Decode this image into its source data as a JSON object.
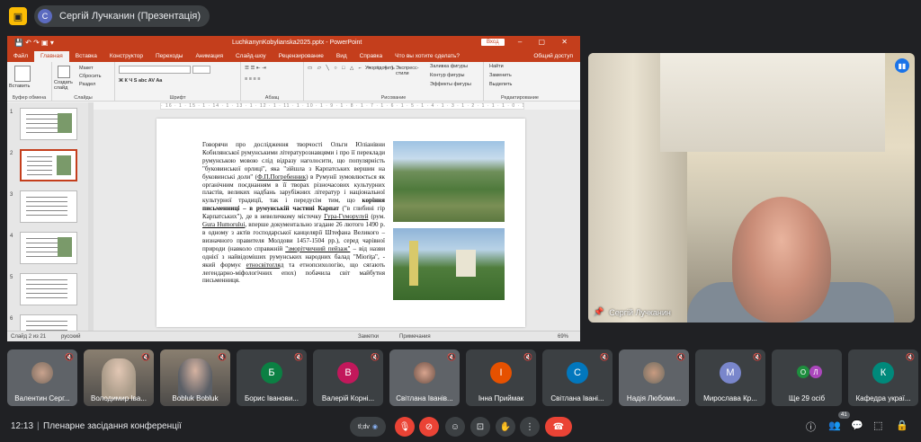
{
  "topbar": {
    "logo_letter": "",
    "presenter_initial": "С",
    "presenter_label": "Сергій Лучканин (Презентація)"
  },
  "powerpoint": {
    "title": "LuchkanynKobylianska2025.pptx - PowerPoint",
    "sign_in": "Вход",
    "tabs": [
      "Файл",
      "Главная",
      "Вставка",
      "Конструктор",
      "Переходы",
      "Анимация",
      "Слайд-шоу",
      "Рецензирование",
      "Вид",
      "Справка",
      "Что вы хотите сделать?"
    ],
    "active_tab": "Главная",
    "share": "Общий доступ",
    "ribbon": {
      "groups": [
        "Буфер обмена",
        "Слайды",
        "Шрифт",
        "Абзац",
        "Рисование",
        "Редактирование"
      ],
      "paste": "Вставить",
      "layout": "Макет",
      "reset": "Сбросить",
      "new_slide": "Создать слайд",
      "section": "Раздел",
      "arrange": "Упорядочить",
      "quick_styles": "Экспресс-стили",
      "fill": "Заливка фигуры",
      "outline": "Контур фигуры",
      "effects": "Эффекты фигуры",
      "find": "Найти",
      "replace": "Заменить",
      "select": "Выделить"
    },
    "ruler": "· 16 · 1 · 15 · 1 · 14 · 1 · 13 · 1 · 12 · 1 · 11 · 1 · 10 · 1 · 9 · 1 · 8 · 1 · 7 · 1 · 6 · 1 · 5 · 1 · 4 · 1 · 3 · 1 · 2 · 1 · 1 · 1 · 0 · 1 · 1 · 2 · 1 · 3 · 1 · 4 · 1 · 5 · 1 · 6 · 1 · 7 · 1 · 8 · 1 · 9 · 1 · 10 · 1 · 11 · 1 · 12 · 1 · 13 · 1 · 14 · 1 · 15 · 1 · 16 ·",
    "thumb_numbers": [
      "1",
      "2",
      "3",
      "4",
      "5",
      "6"
    ],
    "status": {
      "slide": "Слайд 2 из 21",
      "lang": "русский",
      "notes": "Заметки",
      "comments": "Примечания",
      "zoom": "69%"
    }
  },
  "slide": {
    "p1": "Говорячи про дослідження творчості Ольги Юліанівни Кобилянської румунськими літературознавцями і про її переклади румунською мовою слід відразу наголосити, що популярність \"буковинської орлиці\", яка \"зійшла з Карпатських вершин на буковинські доли\" (",
    "p1_link": "Ф.П.Погребенник",
    "p2": ") в Румунії зумовлюється як органічним поєднанням в її творах різночасових культурних пластів, великих надбань зарубіжних літератур і національної культурної традиції, так і передусім тим, що ",
    "p2_bold": "коріння письменниці – в румунській частині Карпат",
    "p3": " (\"в глибині гір Карпатських\"), де в невеличкому містечку ",
    "p3_link": "Гура-Гуморулуй",
    "p4": " (рум. ",
    "p4_link": "Gura Humorului",
    "p5": ", вперше документально згадане 26 лютого 1490 р. в одному з актів господарської канцелярії Штефана Великого – визначного правителя Молдови 1457-1504 рр.), серед чарівної природи (навколо справжній ",
    "p5_link": "\"зморітчичний пейзаж\"",
    "p6": " – від назви однієї з найвідоміших румунських народних балад \"Mioriţa\", - який формує ",
    "p6_link": "етносвітогляд",
    "p7": " та етнопсихологію, що сягають легендарно-міфологічних епох) побачила світ майбутня письменниця."
  },
  "main_tile": {
    "name": "Сергій Лучканин"
  },
  "participants": [
    {
      "name": "Валентин Серг...",
      "initial": "",
      "color": "",
      "type": "cam"
    },
    {
      "name": "Володимир Іва...",
      "initial": "",
      "color": "",
      "type": "cam"
    },
    {
      "name": "Bobluk Bobluk",
      "initial": "",
      "color": "",
      "type": "cam"
    },
    {
      "name": "Борис Іванови...",
      "initial": "Б",
      "color": "#0b8043"
    },
    {
      "name": "Валерій Корні...",
      "initial": "В",
      "color": "#c2185b"
    },
    {
      "name": "Світлана Іванів...",
      "initial": "",
      "color": "",
      "type": "cam"
    },
    {
      "name": "Інна Приймак",
      "initial": "І",
      "color": "#e65100"
    },
    {
      "name": "Світлана Іванi...",
      "initial": "С",
      "color": "#0277bd"
    },
    {
      "name": "Надія Любоми...",
      "initial": "",
      "color": "",
      "type": "cam"
    },
    {
      "name": "Мирослава Кр...",
      "initial": "М",
      "color": "#7986cb"
    },
    {
      "name": "Ще 29 осіб",
      "initial": "",
      "color": "",
      "type": "more",
      "more_initials": [
        "О",
        "Л"
      ]
    },
    {
      "name": "Кафедра украї...",
      "initial": "К",
      "color": "#00897b"
    }
  ],
  "bottombar": {
    "clock": "12:13",
    "separator": "|",
    "meeting": "Пленарне засідання конференції",
    "fx_label": "tl;dv",
    "people_count": "41"
  }
}
